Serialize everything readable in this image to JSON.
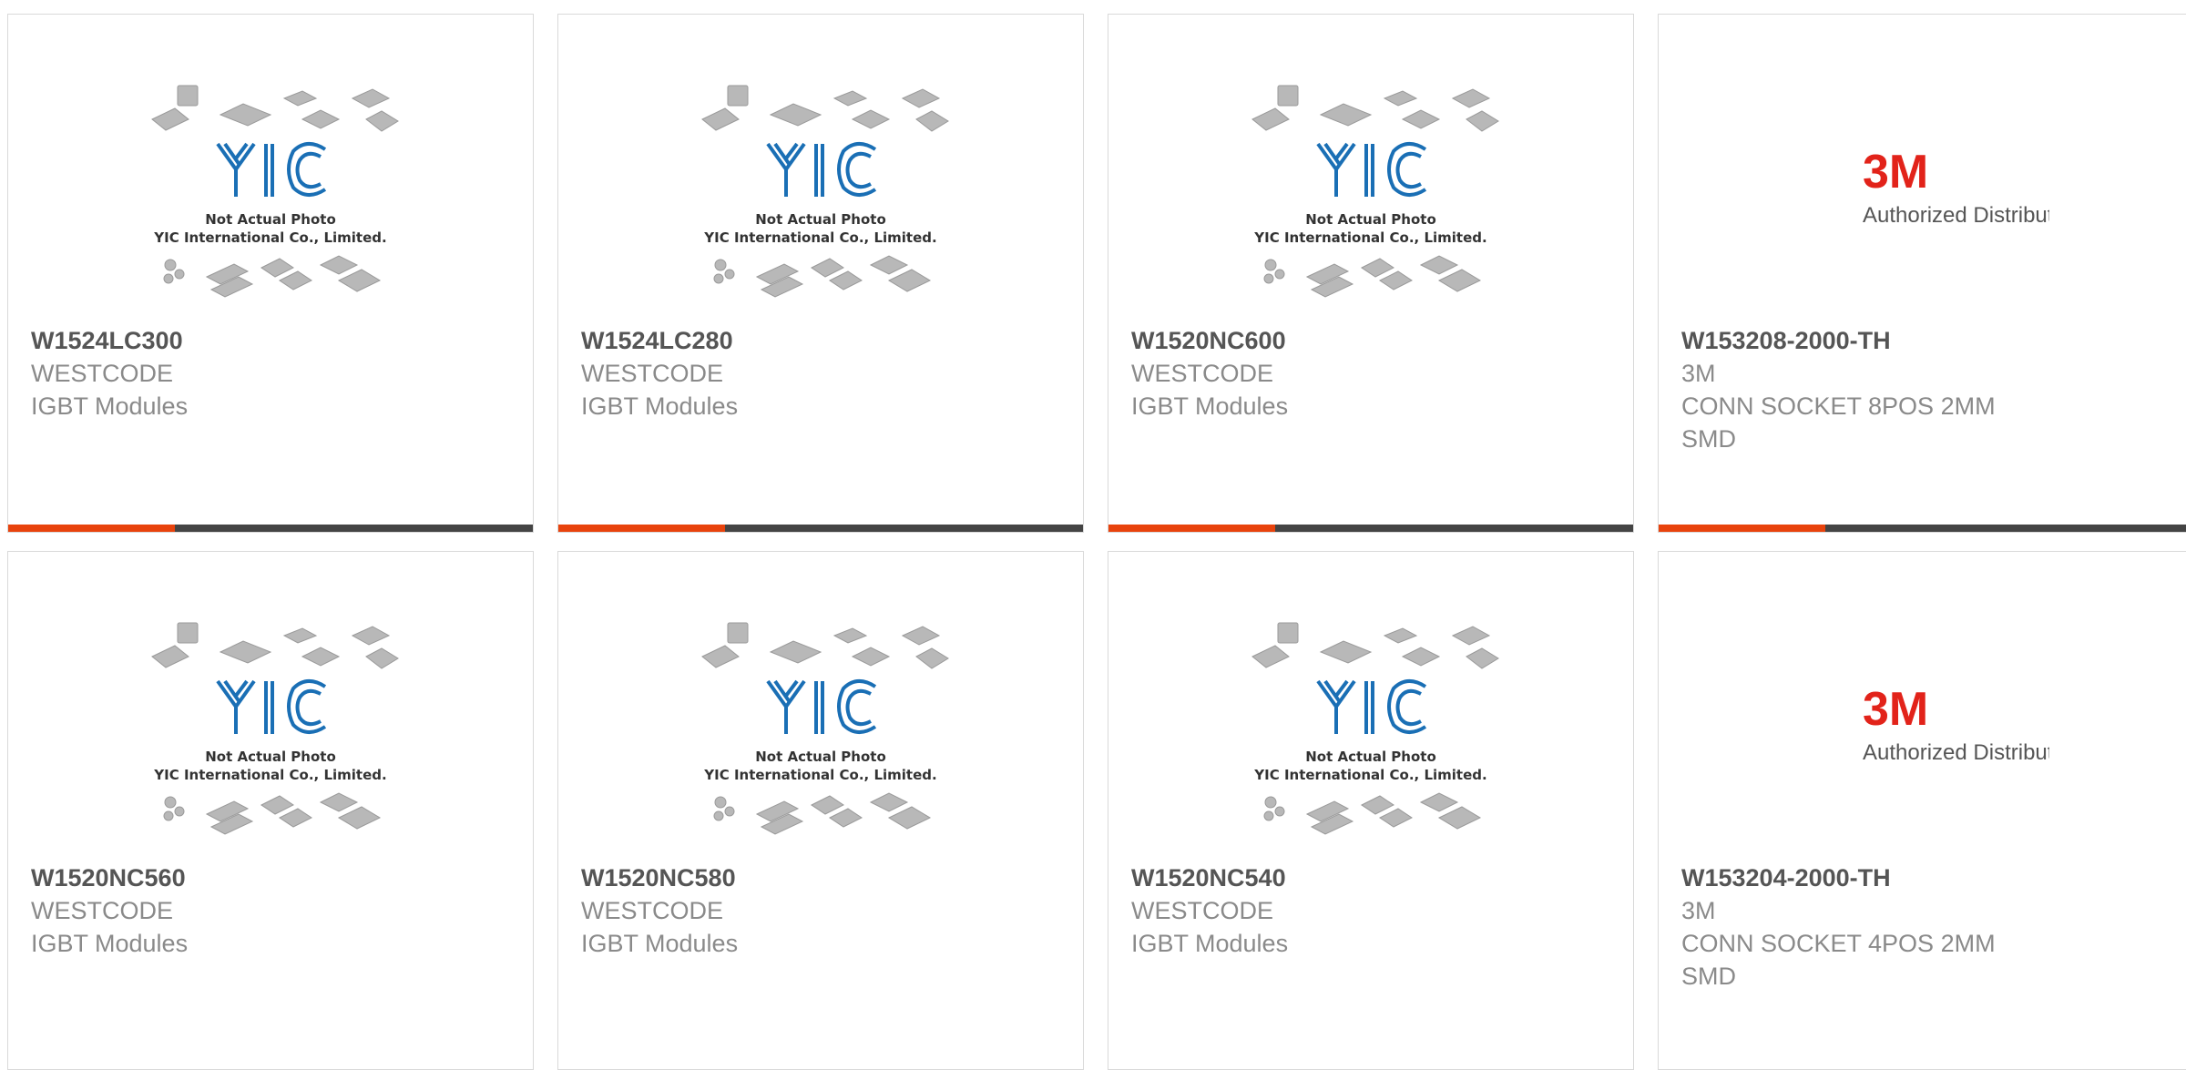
{
  "products": [
    {
      "part": "W1524LC300",
      "brand": "WESTCODE",
      "desc": "IGBT Modules",
      "image_type": "yic"
    },
    {
      "part": "W1524LC280",
      "brand": "WESTCODE",
      "desc": "IGBT Modules",
      "image_type": "yic"
    },
    {
      "part": "W1520NC600",
      "brand": "WESTCODE",
      "desc": "IGBT Modules",
      "image_type": "yic"
    },
    {
      "part": "W153208-2000-TH",
      "brand": "3M",
      "desc": "CONN SOCKET 8POS 2MM SMD",
      "image_type": "3m"
    },
    {
      "part": "W1520NC560",
      "brand": "WESTCODE",
      "desc": "IGBT Modules",
      "image_type": "yic"
    },
    {
      "part": "W1520NC580",
      "brand": "WESTCODE",
      "desc": "IGBT Modules",
      "image_type": "yic"
    },
    {
      "part": "W1520NC540",
      "brand": "WESTCODE",
      "desc": "IGBT Modules",
      "image_type": "yic"
    },
    {
      "part": "W153204-2000-TH",
      "brand": "3M",
      "desc": "CONN SOCKET 4POS 2MM SMD",
      "image_type": "3m"
    }
  ],
  "yic_logo": {
    "text": "YIC",
    "caption_1": "Not Actual Photo",
    "caption_2": "YIC International Co., Limited."
  },
  "threem_logo": {
    "text": "3M",
    "caption": "Authorized Distributor"
  },
  "colors": {
    "accent": "#e8430d",
    "bar": "#444444",
    "yic_blue": "#1a6fb5",
    "threem_red": "#e2231a"
  }
}
